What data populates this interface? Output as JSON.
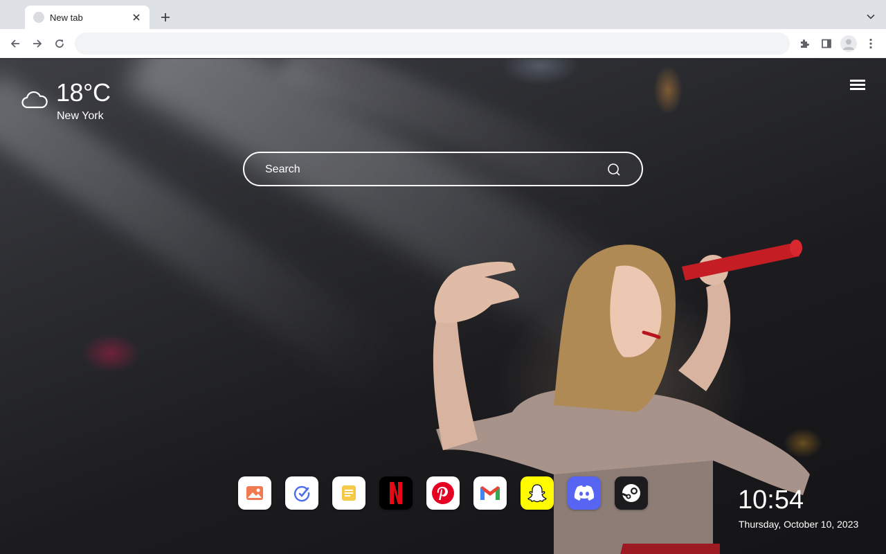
{
  "browser": {
    "tab": {
      "title": "New tab"
    },
    "omnibox": {
      "value": "",
      "placeholder": ""
    }
  },
  "weather": {
    "temperature": "18°C",
    "city": "New York",
    "icon": "cloud-icon"
  },
  "search": {
    "placeholder": "Search"
  },
  "dock": {
    "apps": [
      {
        "name": "Photos",
        "icon": "photo-icon",
        "bg": "#ffffff"
      },
      {
        "name": "Tasks",
        "icon": "check-icon",
        "bg": "#ffffff"
      },
      {
        "name": "Notes",
        "icon": "note-icon",
        "bg": "#ffffff"
      },
      {
        "name": "Netflix",
        "icon": "netflix-icon",
        "bg": "#000000"
      },
      {
        "name": "Pinterest",
        "icon": "pinterest-icon",
        "bg": "#ffffff"
      },
      {
        "name": "Gmail",
        "icon": "gmail-icon",
        "bg": "#ffffff"
      },
      {
        "name": "Snapchat",
        "icon": "snapchat-icon",
        "bg": "#fffc00"
      },
      {
        "name": "Discord",
        "icon": "discord-icon",
        "bg": "#5865f2"
      },
      {
        "name": "Steam",
        "icon": "steam-icon",
        "bg": "#1b1b1d"
      }
    ]
  },
  "clock": {
    "time": "10:54",
    "date": "Thursday, October 10, 2023"
  }
}
